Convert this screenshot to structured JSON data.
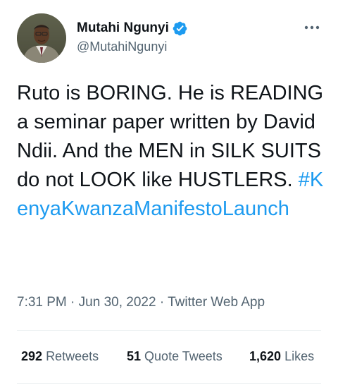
{
  "author": {
    "display_name": "Mutahi Ngunyi",
    "handle": "@MutahiNgunyi",
    "verified": true
  },
  "tweet": {
    "text": "Ruto is BORING. He is READING a seminar paper written by David Ndii. And the MEN in SILK SUITS do not LOOK like HUSTLERS. ",
    "hashtag": "#KenyaKwanzaManifestoLaunch"
  },
  "meta": {
    "time": "7:31 PM",
    "separator": "·",
    "date": "Jun 30, 2022",
    "source": "Twitter Web App"
  },
  "stats": {
    "retweets_count": "292",
    "retweets_label": "Retweets",
    "quotes_count": "51",
    "quotes_label": "Quote Tweets",
    "likes_count": "1,620",
    "likes_label": "Likes"
  },
  "colors": {
    "accent": "#1d9bf0",
    "secondary_text": "#536471",
    "primary_text": "#0f1419",
    "divider": "#eff3f4"
  },
  "icons": {
    "verified": "verified-badge-icon",
    "more": "more-options-icon"
  }
}
